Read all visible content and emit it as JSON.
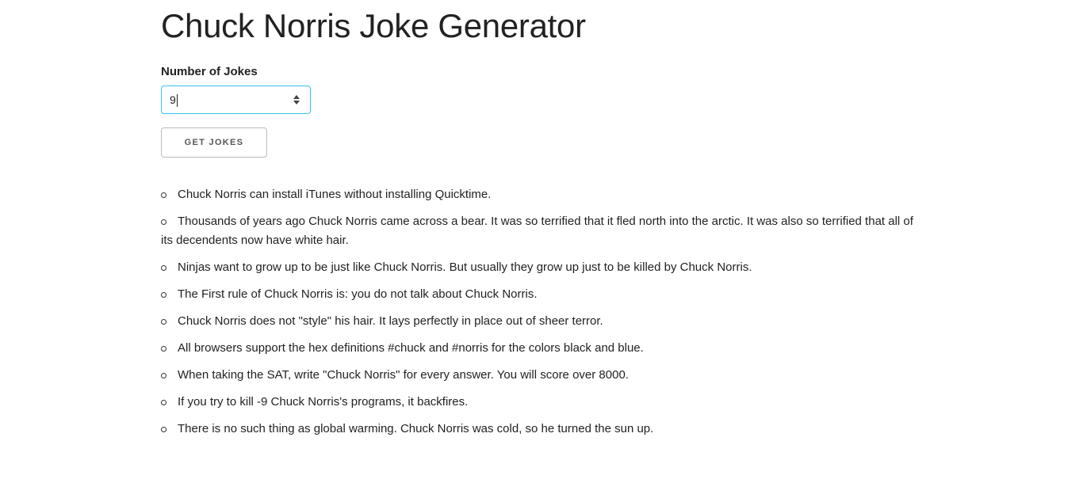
{
  "page": {
    "title": "Chuck Norris Joke Generator"
  },
  "form": {
    "label": "Number of Jokes",
    "number_value": "9",
    "button_label": "GET JOKES"
  },
  "jokes": [
    "Chuck Norris can install iTunes without installing Quicktime.",
    "Thousands of years ago Chuck Norris came across a bear. It was so terrified that it fled north into the arctic. It was also so terrified that all of its decendents now have white hair.",
    "Ninjas want to grow up to be just like Chuck Norris. But usually they grow up just to be killed by Chuck Norris.",
    "The First rule of Chuck Norris is: you do not talk about Chuck Norris.",
    "Chuck Norris does not \"style\" his hair. It lays perfectly in place out of sheer terror.",
    "All browsers support the hex definitions #chuck and #norris for the colors black and blue.",
    "When taking the SAT, write \"Chuck Norris\" for every answer. You will score over 8000.",
    "If you try to kill -9 Chuck Norris's programs, it backfires.",
    "There is no such thing as global warming. Chuck Norris was cold, so he turned the sun up."
  ],
  "colors": {
    "focus_border": "#33c3f0",
    "text": "#222222",
    "button_border": "#bbbbbb"
  },
  "icons": {
    "spinner": "spinner-arrows-icon",
    "bullet": "hollow-circle-bullet-icon"
  }
}
